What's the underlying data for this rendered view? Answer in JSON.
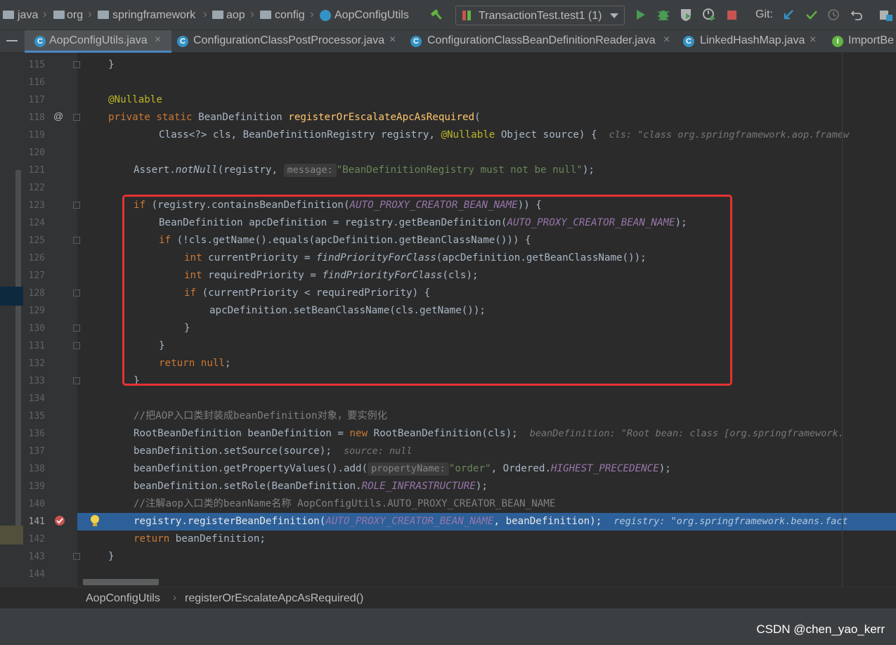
{
  "breadcrumb": [
    "java",
    "org",
    "springframework",
    "aop",
    "config",
    "AopConfigUtils"
  ],
  "run_config": {
    "label": "TransactionTest.test1 (1)"
  },
  "toolbar": {
    "git_label": "Git:"
  },
  "tabs": [
    {
      "label": "AopConfigUtils.java"
    },
    {
      "label": "ConfigurationClassPostProcessor.java"
    },
    {
      "label": "ConfigurationClassBeanDefinitionReader.java"
    },
    {
      "label": "LinkedHashMap.java"
    },
    {
      "label": "ImportBe"
    }
  ],
  "lines": [
    {
      "n": "115",
      "t": "}"
    },
    {
      "n": "116"
    },
    {
      "n": "117",
      "t": "@Nullable"
    },
    {
      "n": "118",
      "t1": "private static",
      "t2": "BeanDefinition",
      "t3": "registerOrEscalateApcAsRequired",
      "t4": "("
    },
    {
      "n": "119",
      "t1": "Class<?> cls, BeanDefinitionRegistry registry, ",
      "t2": "@Nullable",
      "t3": " Object source) {",
      "hint": "cls: \"class org.springframework.aop.framew"
    },
    {
      "n": "120"
    },
    {
      "n": "121",
      "t1": "Assert.",
      "t2": "notNull",
      "t3": "(registry, ",
      "pname": "message:",
      "str": "\"BeanDefinitionRegistry must not be null\"",
      "t4": ");"
    },
    {
      "n": "122"
    },
    {
      "n": "123",
      "kw": "if",
      "t1": " (registry.containsBeanDefinition(",
      "c": "AUTO_PROXY_CREATOR_BEAN_NAME",
      "t2": ")) {"
    },
    {
      "n": "124",
      "t1": "BeanDefinition apcDefinition = registry.getBeanDefinition(",
      "c": "AUTO_PROXY_CREATOR_BEAN_NAME",
      "t2": ");"
    },
    {
      "n": "125",
      "kw": "if",
      "t1": " (!cls.getName().equals(apcDefinition.getBeanClassName())) {"
    },
    {
      "n": "126",
      "kw": "int",
      "t1": " currentPriority = ",
      "m": "findPriorityForClass",
      "t2": "(apcDefinition.getBeanClassName());"
    },
    {
      "n": "127",
      "kw": "int",
      "t1": " requiredPriority = ",
      "m": "findPriorityForClass",
      "t2": "(cls);"
    },
    {
      "n": "128",
      "kw": "if",
      "t1": " (currentPriority < requiredPriority) {"
    },
    {
      "n": "129",
      "t": "apcDefinition.setBeanClassName(cls.getName());"
    },
    {
      "n": "130",
      "t": "}"
    },
    {
      "n": "131",
      "t": "}"
    },
    {
      "n": "132",
      "kw": "return null",
      "t1": ";"
    },
    {
      "n": "133",
      "t": "}"
    },
    {
      "n": "134"
    },
    {
      "n": "135",
      "t": "//把AOP入口类封装成beanDefinition对象，要实例化"
    },
    {
      "n": "136",
      "t1": "RootBeanDefinition beanDefinition = ",
      "kw": "new",
      "t2": " RootBeanDefinition(cls);",
      "hint": "beanDefinition: \"Root bean: class [org.springframework."
    },
    {
      "n": "137",
      "t1": "beanDefinition.setSource(source);",
      "hint": "source: null"
    },
    {
      "n": "138",
      "t1": "beanDefinition.getPropertyValues().add(",
      "pname": "propertyName:",
      "str": "\"order\"",
      "t2": ", Ordered.",
      "c": "HIGHEST_PRECEDENCE",
      "t3": ");"
    },
    {
      "n": "139",
      "t1": "beanDefinition.setRole(BeanDefinition.",
      "c": "ROLE_INFRASTRUCTURE",
      "t2": ");"
    },
    {
      "n": "140",
      "t": "//注解aop入口类的beanName名称 AopConfigUtils.AUTO_PROXY_CREATOR_BEAN_NAME"
    },
    {
      "n": "141",
      "t1": "registry.registerBeanDefinition(",
      "c": "AUTO_PROXY_CREATOR_BEAN_NAME",
      "t2": ", beanDefinition);",
      "hint": "registry: \"org.springframework.beans.fact"
    },
    {
      "n": "142",
      "kw": "return",
      "t1": " beanDefinition;"
    },
    {
      "n": "143",
      "t": "}"
    },
    {
      "n": "144"
    }
  ],
  "footer": {
    "class_name": "AopConfigUtils",
    "method_name": "registerOrEscalateApcAsRequired()"
  },
  "watermark": "CSDN @chen_yao_kerr",
  "colors": {
    "background": "#2b2b2b",
    "keyword": "#cc7832",
    "annotation": "#bbb529",
    "string": "#6a8759",
    "constant": "#9876aa",
    "method_decl": "#ffc66d",
    "comment": "#808080",
    "execution_line": "#2d6099",
    "red_box": "#e53232"
  },
  "icons": [
    "folder-icon",
    "class-icon",
    "build-hammer-icon",
    "run-icon",
    "debug-icon",
    "coverage-icon",
    "profile-icon",
    "stop-icon",
    "git-update-icon",
    "git-commit-icon",
    "git-history-icon",
    "undo-icon",
    "project-structure-icon",
    "breakpoint-icon",
    "lightbulb-icon",
    "override-icon"
  ]
}
